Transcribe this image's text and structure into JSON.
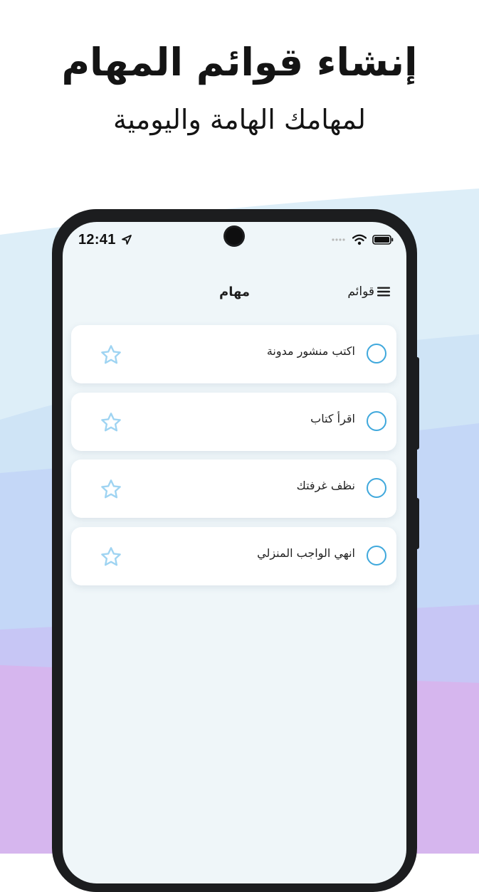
{
  "header": {
    "title": "إنشاء قوائم المهام",
    "subtitle": "لمهامك الهامة واليومية"
  },
  "status_bar": {
    "time": "12:41",
    "icons": [
      "location-arrow-icon",
      "signal-dots-icon",
      "wifi-icon",
      "battery-icon"
    ]
  },
  "nav": {
    "title": "مهام",
    "lists_label": "قوائم",
    "lists_icon": "menu-icon"
  },
  "tasks": [
    {
      "label": "اكتب منشور مدونة"
    },
    {
      "label": "اقرأ كتاب"
    },
    {
      "label": "نظف غرفتك"
    },
    {
      "label": "انهي الواجب المنزلي"
    }
  ],
  "colors": {
    "accent": "#3fa8dc",
    "star": "#9fd4f2",
    "screen_bg": "#eff6f9",
    "phone_frame": "#1c1d1f"
  }
}
